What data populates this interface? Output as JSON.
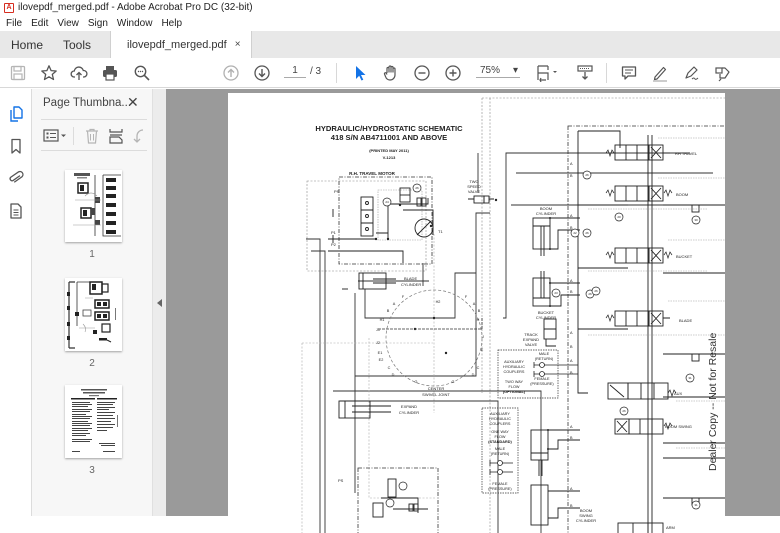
{
  "window": {
    "title": "ilovepdf_merged.pdf - Adobe Acrobat Pro DC (32-bit)",
    "app_icon": "acrobat-pdf-icon"
  },
  "menu": [
    "File",
    "Edit",
    "View",
    "Sign",
    "Window",
    "Help"
  ],
  "tabs": {
    "home": "Home",
    "tools": "Tools",
    "document": "ilovepdf_merged.pdf",
    "close": "×"
  },
  "toolbar": {
    "icons": [
      "save-icon",
      "bookmark-star-icon",
      "upload-cloud-icon",
      "print-icon",
      "find-zoom-icon",
      "page-up-icon",
      "page-down-icon",
      "select-cursor-icon",
      "hand-tool-icon",
      "zoom-out-icon",
      "zoom-in-icon",
      "fit-page-icon",
      "scroll-mode-icon",
      "comment-icon",
      "highlight-pen-icon",
      "sign-icon",
      "share-icon"
    ],
    "current_page": "1",
    "total_pages": "/ 3",
    "zoom": "75%",
    "zoom_caret": "▾",
    "accent": "#1473e6"
  },
  "left_rail": {
    "icons": [
      "page-thumbnails-icon",
      "bookmark-icon",
      "attachment-icon",
      "document-properties-icon"
    ]
  },
  "thumbnails_panel": {
    "title": "Page Thumbna...",
    "close": "✕",
    "tools": [
      "options-menu-icon",
      "delete-page-icon",
      "insert-page-icon",
      "undo-icon"
    ],
    "pages": [
      {
        "number": "1",
        "selected": false
      },
      {
        "number": "2",
        "selected": false
      },
      {
        "number": "3",
        "selected": false
      }
    ]
  },
  "document": {
    "title_line1": "HYDRAULIC/HYDROSTATIC SCHEMATIC",
    "title_line2": "418 S/N AB4711001 AND ABOVE",
    "printed": "(PRINTED MAY 2011)",
    "code": "V-1213",
    "watermark": "Dealer Copy -- Not for Resale",
    "labels": {
      "rh_travel_motor": "R.H. TRAVEL MOTOR",
      "two_speed_valve": [
        "TWO",
        "SPEED",
        "VALVE"
      ],
      "blade_cylinder": [
        "BLADE",
        "CYLINDER"
      ],
      "boom_cylinder": [
        "BOOM",
        "CYLINDER"
      ],
      "bucket_cylinder": [
        "BUCKET",
        "CYLINDER"
      ],
      "track_expand_valve": [
        "TRACK",
        "EXPAND",
        "VALVE"
      ],
      "center_swivel_joint": [
        "CENTER",
        "SWIVEL JOINT"
      ],
      "expand_cylinder": [
        "EXPAND",
        "CYLINDER"
      ],
      "aux_couplers_two_way": [
        "AUXILIARY",
        "HYDRAULIC",
        "COUPLERS",
        "TWO WAY",
        "FLOW",
        "(OPTIONAL)"
      ],
      "male_return": [
        "MALE",
        "(RETURN)"
      ],
      "female_pressure": [
        "FEMALE",
        "(PRESSURE)"
      ],
      "aux_couplers_one_way": [
        "AUXILIARY",
        "HYDRAULIC",
        "COUPLERS",
        "ONE WAY",
        "FLOW",
        "(STANDARD)",
        "MALE",
        "(RETURN)",
        "FEMALE",
        "(PRESSURE)"
      ],
      "boom_swing_cylinder": [
        "BOOM",
        "SWING",
        "CYLINDER"
      ],
      "rh_travel": "RH TRAVEL",
      "boom": "BOOM",
      "bucket": "BUCKET",
      "blade": "BLADE",
      "aux": "AUX",
      "boom_swing": "BOOM SWING",
      "arm": "ARM",
      "ports": [
        "PS",
        "P1",
        "P2",
        "T1",
        "H2",
        "H1",
        "J1",
        "J2",
        "E1",
        "E2",
        "A",
        "B",
        "C",
        "D",
        "E",
        "F",
        "G",
        "H",
        "J"
      ],
      "callouts": [
        "26",
        "24",
        "20",
        "21",
        "22",
        "23",
        "25",
        "30",
        "31"
      ]
    }
  }
}
